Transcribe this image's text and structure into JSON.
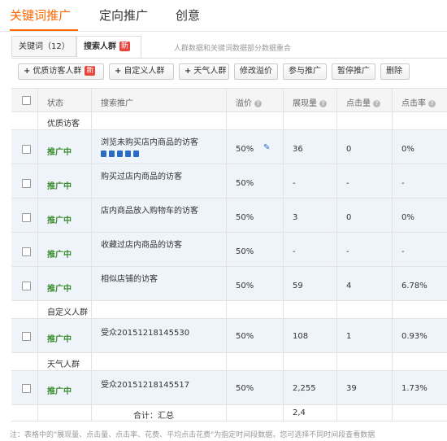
{
  "top_tabs": [
    "关键词推广",
    "定向推广",
    "创意"
  ],
  "sub_tabs": {
    "keywords": "关键词（12）",
    "crowd": "搜索人群",
    "new_badge": "新",
    "note": "人群数据和关键词数据部分数据重合"
  },
  "toolbar": {
    "quality_visitor": "优质访客人群",
    "new_badge": "新",
    "custom_crowd": "自定义人群",
    "weather_crowd": "天气人群",
    "edit_premium": "修改溢价",
    "join_promo": "参与推广",
    "pause_promo": "暂停推广",
    "delete": "删除"
  },
  "table": {
    "headers": {
      "status": "状态",
      "search_promo": "搜索推广",
      "premium": "溢价",
      "impressions": "展现量",
      "clicks": "点击量",
      "ctr": "点击率"
    },
    "groups": {
      "quality": "优质访客",
      "custom": "自定义人群",
      "weather": "天气人群"
    },
    "rows": [
      {
        "status": "推广中",
        "name": "浏览未购买店内商品的访客",
        "premium": "50%",
        "impressions": "36",
        "clicks": "0",
        "ctr": "0%"
      },
      {
        "status": "推广中",
        "name": "购买过店内商品的访客",
        "premium": "50%",
        "impressions": "-",
        "clicks": "-",
        "ctr": "-"
      },
      {
        "status": "推广中",
        "name": "店内商品放入购物车的访客",
        "premium": "50%",
        "impressions": "3",
        "clicks": "0",
        "ctr": "0%"
      },
      {
        "status": "推广中",
        "name": "收藏过店内商品的访客",
        "premium": "50%",
        "impressions": "-",
        "clicks": "-",
        "ctr": "-"
      },
      {
        "status": "推广中",
        "name": "相似店铺的访客",
        "premium": "50%",
        "impressions": "59",
        "clicks": "4",
        "ctr": "6.78%"
      },
      {
        "status": "推广中",
        "name": "受众20151218145530",
        "premium": "50%",
        "impressions": "108",
        "clicks": "1",
        "ctr": "0.93%"
      },
      {
        "status": "推广中",
        "name": "受众20151218145517",
        "premium": "50%",
        "impressions": "2,255",
        "clicks": "39",
        "ctr": "1.73%"
      }
    ],
    "total_label": "合计：汇总",
    "total_impressions": "2,4"
  },
  "footer_note": "注：表格中的\"展现量、点击量、点击率、花费、平均点击花费\"为指定时间段数据，您可选择不同时间段查看数据"
}
